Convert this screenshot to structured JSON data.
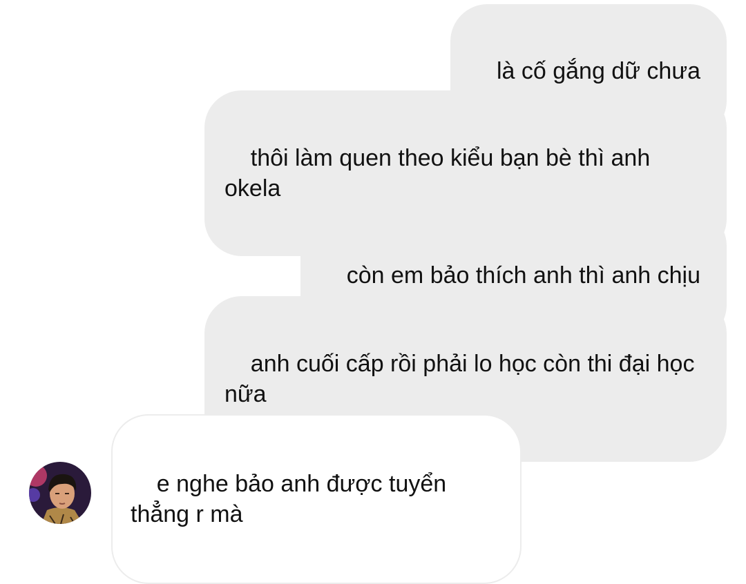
{
  "conversation": {
    "messages": [
      {
        "direction": "sent",
        "text": "là cố gắng dữ chưa"
      },
      {
        "direction": "sent",
        "text": "thôi làm quen theo kiểu bạn bè thì anh okela"
      },
      {
        "direction": "sent",
        "text": "còn em bảo thích anh thì anh chịu"
      },
      {
        "direction": "sent",
        "text": "anh cuối cấp rồi phải lo học còn thi đại học nữa"
      },
      {
        "direction": "received",
        "text": "e nghe bảo anh được tuyển thẳng r mà"
      }
    ],
    "contact_avatar": {
      "icon": "contact-avatar-photo",
      "colors": {
        "background": "#2a1a3a",
        "accent": "#d04070",
        "skin": "#d9a07a",
        "hair": "#1a1410",
        "shirt": "#b08848"
      }
    }
  },
  "theme": {
    "sent_bubble_color": "#ececec",
    "received_bubble_border": "#ececec",
    "text_color": "#111111",
    "background": "#ffffff"
  }
}
